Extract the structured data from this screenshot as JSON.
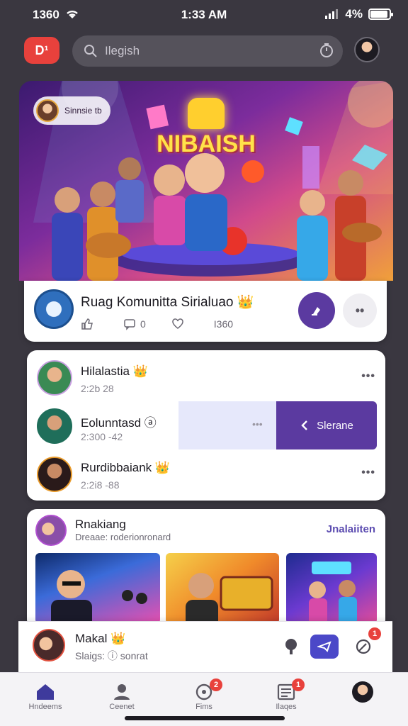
{
  "status_bar": {
    "time_left": "1360",
    "time_center": "1:33 AM",
    "battery_pct": "4%"
  },
  "header": {
    "logo_text": "D¹",
    "search_placeholder": "Ilegish"
  },
  "banner": {
    "chip_label": "Sinnsie tb",
    "title": "NIBAISH"
  },
  "room": {
    "title": "Ruag Komunitta Sirialuao 👑",
    "stats": {
      "likes": "",
      "comments": "0",
      "shares": "",
      "views": "I360"
    }
  },
  "chats": [
    {
      "name": "Hilalastia 👑",
      "time": "2:2b 28"
    },
    {
      "name": "Eolunntasd ⓐ",
      "time": "2:300 -42"
    },
    {
      "name": "Rurdibbaiank 👑",
      "time": "2:2i8 -88"
    }
  ],
  "swipe_action_label": "Slerane",
  "ranking": {
    "title": "Rnakiang",
    "subtitle": "Dreaae: roderionronard",
    "link": "Jnalaiiten"
  },
  "mini_player": {
    "title": "Makal 👑",
    "subtitle": "Slaigs: ⓘ sonrat",
    "badge_count": "1"
  },
  "tabs": [
    {
      "label": "Hndeems",
      "icon": "home-icon",
      "badge": ""
    },
    {
      "label": "Ceenet",
      "icon": "people-icon",
      "badge": ""
    },
    {
      "label": "Fims",
      "icon": "chat-icon",
      "badge": "2"
    },
    {
      "label": "Ilaqes",
      "icon": "news-icon",
      "badge": "1"
    },
    {
      "label": "",
      "icon": "profile-avatar",
      "badge": ""
    }
  ],
  "colors": {
    "accent": "#5b3aa0",
    "logo": "#e8413c",
    "badge": "#e8413c",
    "link": "#5b4bb0"
  }
}
